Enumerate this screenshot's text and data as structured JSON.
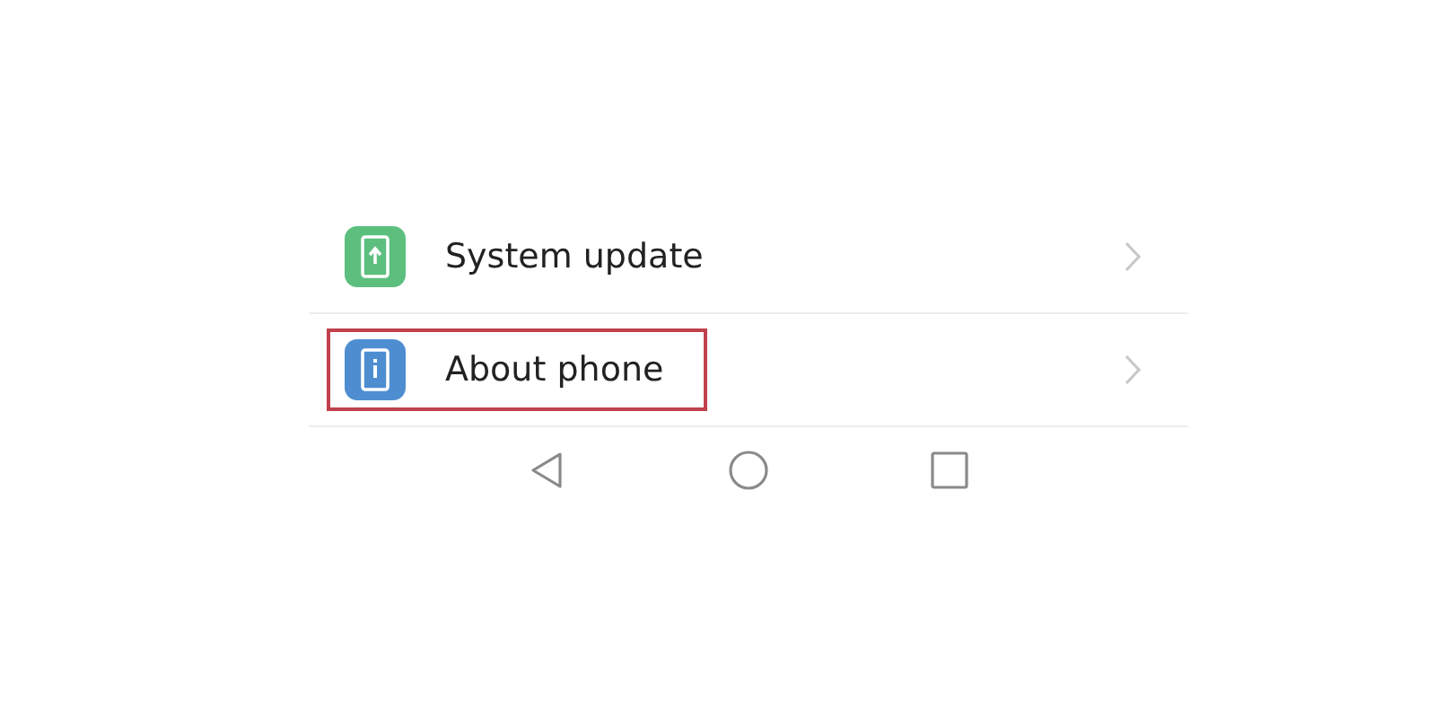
{
  "settings_items": [
    {
      "kind": "update",
      "label": "System update",
      "color": "#5cbf7e",
      "highlighted": false
    },
    {
      "kind": "info",
      "label": "About phone",
      "color": "#4e8ed0",
      "highlighted": true
    }
  ],
  "nav_buttons": [
    {
      "kind": "back"
    },
    {
      "kind": "home"
    },
    {
      "kind": "recents"
    }
  ]
}
